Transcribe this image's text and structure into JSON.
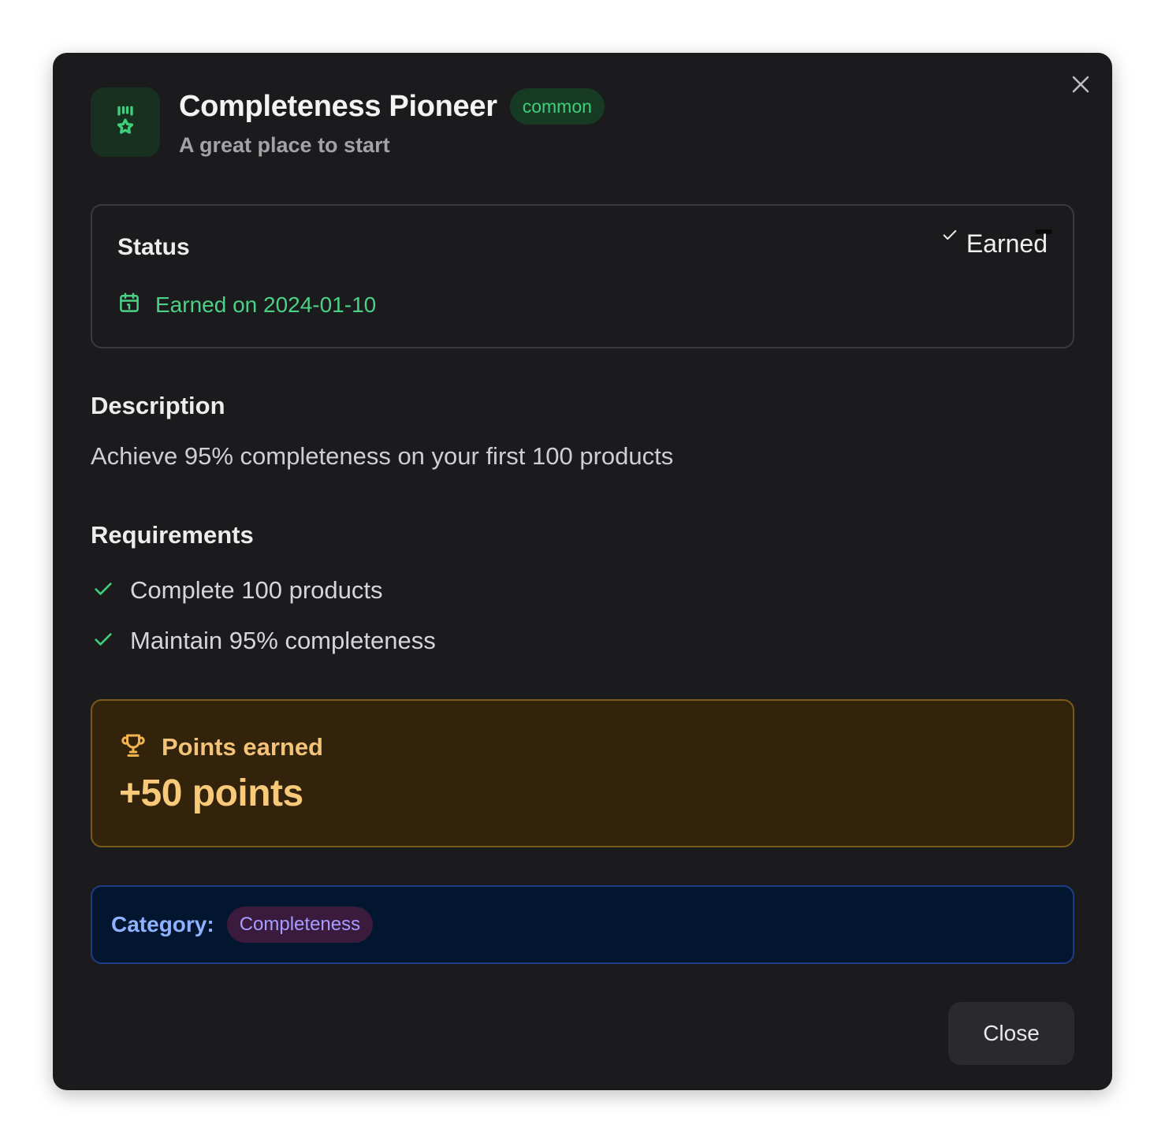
{
  "dialog": {
    "title": "Completeness Pioneer",
    "rarity": "common",
    "subtitle": "A great place to start",
    "icon": "medal-icon"
  },
  "status": {
    "label": "Status",
    "state": "Earned",
    "earned_date": "Earned on 2024-01-10"
  },
  "description": {
    "heading": "Description",
    "text": "Achieve 95% completeness on your first 100 products"
  },
  "requirements": {
    "heading": "Requirements",
    "items": [
      "Complete 100 products",
      "Maintain 95% completeness"
    ]
  },
  "points": {
    "label": "Points earned",
    "value": "+50 points"
  },
  "category": {
    "label": "Category:",
    "value": "Completeness"
  },
  "footer": {
    "close_label": "Close"
  },
  "colors": {
    "background": "#1b1b1d",
    "accent_green": "#3fcf7a",
    "points_gold": "#f7c978",
    "category_blue": "#8fb2ff"
  }
}
